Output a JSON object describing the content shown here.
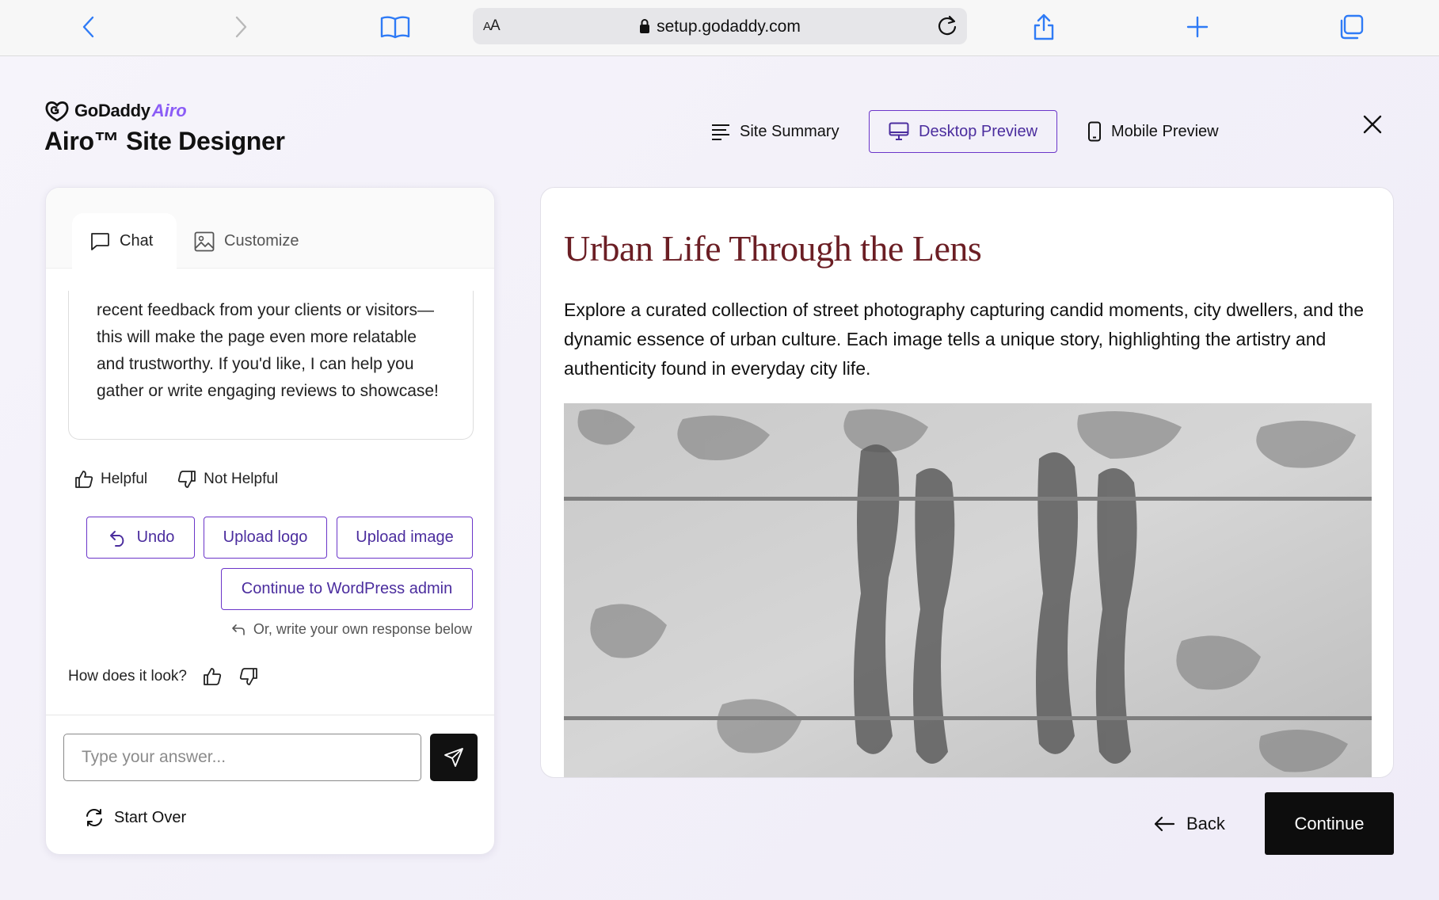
{
  "browser": {
    "url": "setup.godaddy.com",
    "reader_label_big": "A",
    "reader_label_small": "A"
  },
  "header": {
    "brand_name": "GoDaddy",
    "brand_sub": "Airo",
    "page_title": "Airo™ Site Designer",
    "nav": {
      "site_summary": "Site Summary",
      "desktop_preview": "Desktop Preview",
      "mobile_preview": "Mobile Preview"
    }
  },
  "chat_panel": {
    "tabs": {
      "chat": "Chat",
      "customize": "Customize"
    },
    "message": "recent feedback from your clients or visitors—this will make the page even more relatable and trustworthy. If you'd like, I can help you gather or write engaging reviews to showcase!",
    "feedback": {
      "helpful": "Helpful",
      "not_helpful": "Not Helpful"
    },
    "actions": {
      "undo": "Undo",
      "upload_logo": "Upload logo",
      "upload_image": "Upload image",
      "continue_wp": "Continue to WordPress admin"
    },
    "hint": "Or, write your own response below",
    "look_question": "How does it look?",
    "input_placeholder": "Type your answer...",
    "start_over": "Start Over"
  },
  "preview": {
    "heading": "Urban Life Through the Lens",
    "description": "Explore a curated collection of street photography capturing candid moments, city dwellers, and the dynamic essence of urban culture. Each image tells a unique story, highlighting the artistry and authenticity found in everyday city life."
  },
  "footer": {
    "back": "Back",
    "continue": "Continue"
  },
  "colors": {
    "accent_purple": "#6b35c9",
    "heading_maroon": "#6b1e24",
    "browser_blue": "#2f7bf6"
  }
}
